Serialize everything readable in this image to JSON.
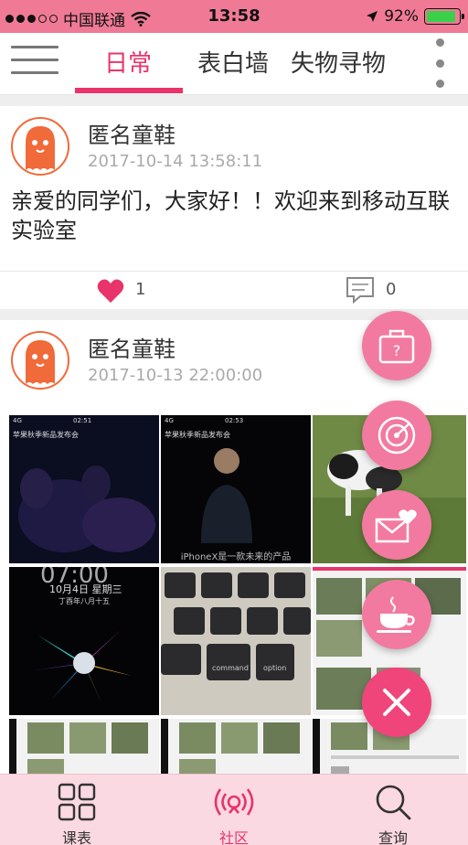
{
  "status_bar": {
    "carrier": "中国联通",
    "time": "13:58",
    "battery": "92%",
    "signal_strength": 3,
    "signal_max": 5,
    "battery_level": 0.92
  },
  "tabs": [
    {
      "label": "日常",
      "active": true
    },
    {
      "label": "表白墙",
      "active": false
    },
    {
      "label": "失物寻物",
      "active": false
    }
  ],
  "posts": [
    {
      "author": "匿名童鞋",
      "time": "2017-10-14 13:58:11",
      "content": "亲爱的同学们，大家好！！欢迎来到移动互联实验室",
      "likes": "1",
      "comments": "0"
    },
    {
      "author": "匿名童鞋",
      "time": "2017-10-13 22:00:00",
      "photos": [
        {
          "top_text_left": "4G",
          "top_text_right": "02:51",
          "caption": "苹果秋季新品发布会"
        },
        {
          "top_text_left": "4G",
          "top_text_right": "02:53",
          "caption": "苹果秋季新品发布会",
          "subtitle": "iPhoneX是一款未来的产品"
        },
        {},
        {
          "clock": "07:00",
          "date": "10月4日 星期三",
          "lunar": "丁酉年八月十五"
        },
        {
          "key_labels": [
            "command",
            "option"
          ]
        },
        {}
      ]
    }
  ],
  "fabs": [
    {
      "name": "lost-found-fab",
      "icon": "lost-found-icon"
    },
    {
      "name": "radar-fab",
      "icon": "radar-icon"
    },
    {
      "name": "love-letter-fab",
      "icon": "love-letter-icon"
    },
    {
      "name": "coffee-fab",
      "icon": "coffee-cup-icon"
    },
    {
      "name": "close-fab",
      "icon": "close-icon"
    }
  ],
  "bottom_nav": [
    {
      "label": "课表",
      "icon": "grid-icon",
      "active": false
    },
    {
      "label": "社区",
      "icon": "community-icon",
      "active": true
    },
    {
      "label": "查询",
      "icon": "search-icon",
      "active": false
    }
  ],
  "colors": {
    "accent": "#e8346a",
    "status_bar": "#f07a96",
    "fab": "#f27aa0",
    "bottom_bar": "#fbd9e2"
  }
}
